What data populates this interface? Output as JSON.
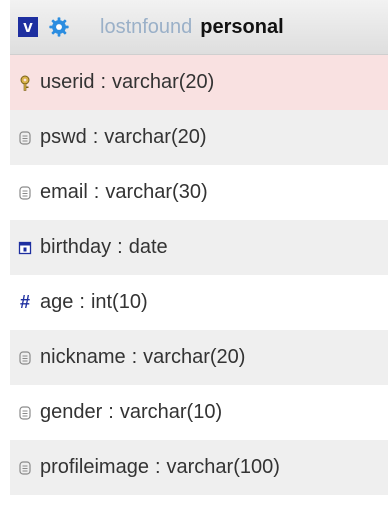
{
  "header": {
    "toggle_label": "v",
    "database": "lostnfound",
    "table": "personal"
  },
  "colors": {
    "primary_key_bg": "#f9e1e1",
    "toggle_bg": "#1e2fa0",
    "database_text": "#9ab0c8"
  },
  "columns": [
    {
      "name": "userid",
      "separator": ":",
      "type": "varchar(20)",
      "icon": "key-icon"
    },
    {
      "name": "pswd",
      "separator": ":",
      "type": "varchar(20)",
      "icon": "text-column-icon"
    },
    {
      "name": "email",
      "separator": ":",
      "type": "varchar(30)",
      "icon": "text-column-icon"
    },
    {
      "name": "birthday",
      "separator": ":",
      "type": "date",
      "icon": "calendar-icon"
    },
    {
      "name": "age",
      "separator": ":",
      "type": "int(10)",
      "icon": "hash-icon"
    },
    {
      "name": "nickname",
      "separator": ":",
      "type": "varchar(20)",
      "icon": "text-column-icon"
    },
    {
      "name": "gender",
      "separator": ":",
      "type": "varchar(10)",
      "icon": "text-column-icon"
    },
    {
      "name": "profileimage",
      "separator": ":",
      "type": "varchar(100)",
      "icon": "text-column-icon"
    }
  ]
}
